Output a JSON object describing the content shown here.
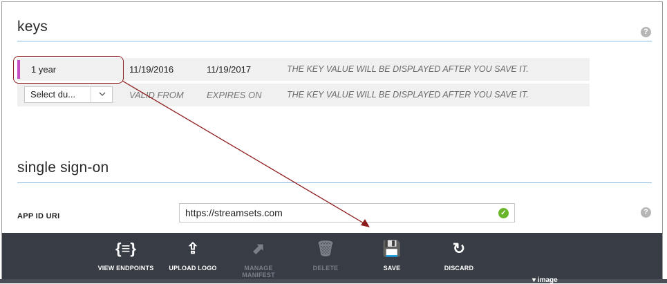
{
  "keys": {
    "title": "keys",
    "rows": [
      {
        "duration": "1 year",
        "valid_from": "11/19/2016",
        "expires_on": "11/19/2017",
        "key_value": "THE KEY VALUE WILL BE DISPLAYED AFTER YOU SAVE IT."
      },
      {
        "duration_select": "Select du...",
        "valid_from": "VALID FROM",
        "expires_on": "EXPIRES ON",
        "key_value": "THE KEY VALUE WILL BE DISPLAYED AFTER YOU SAVE IT."
      }
    ]
  },
  "sso": {
    "title": "single sign-on",
    "app_id_label": "APP ID URI",
    "app_id_value": "https://streamsets.com"
  },
  "help_glyph": "?",
  "commands": [
    {
      "icon": "{≡}",
      "label": "VIEW ENDPOINTS",
      "enabled": true
    },
    {
      "icon": "⇪",
      "label": "UPLOAD LOGO",
      "enabled": true
    },
    {
      "icon": "⬈",
      "label": "MANAGE MANIFEST",
      "enabled": false
    },
    {
      "icon": "🗑",
      "label": "DELETE",
      "enabled": false
    },
    {
      "icon": "💾",
      "label": "SAVE",
      "enabled": true
    },
    {
      "icon": "↻",
      "label": "DISCARD",
      "enabled": true
    }
  ],
  "colors": {
    "accent": "#c64cc3",
    "rule": "#8cbde4",
    "command_bar": "#383c45",
    "annotation": "#8e1b1b",
    "ok": "#68b52b"
  },
  "partial_text_bottom": "▾ image"
}
